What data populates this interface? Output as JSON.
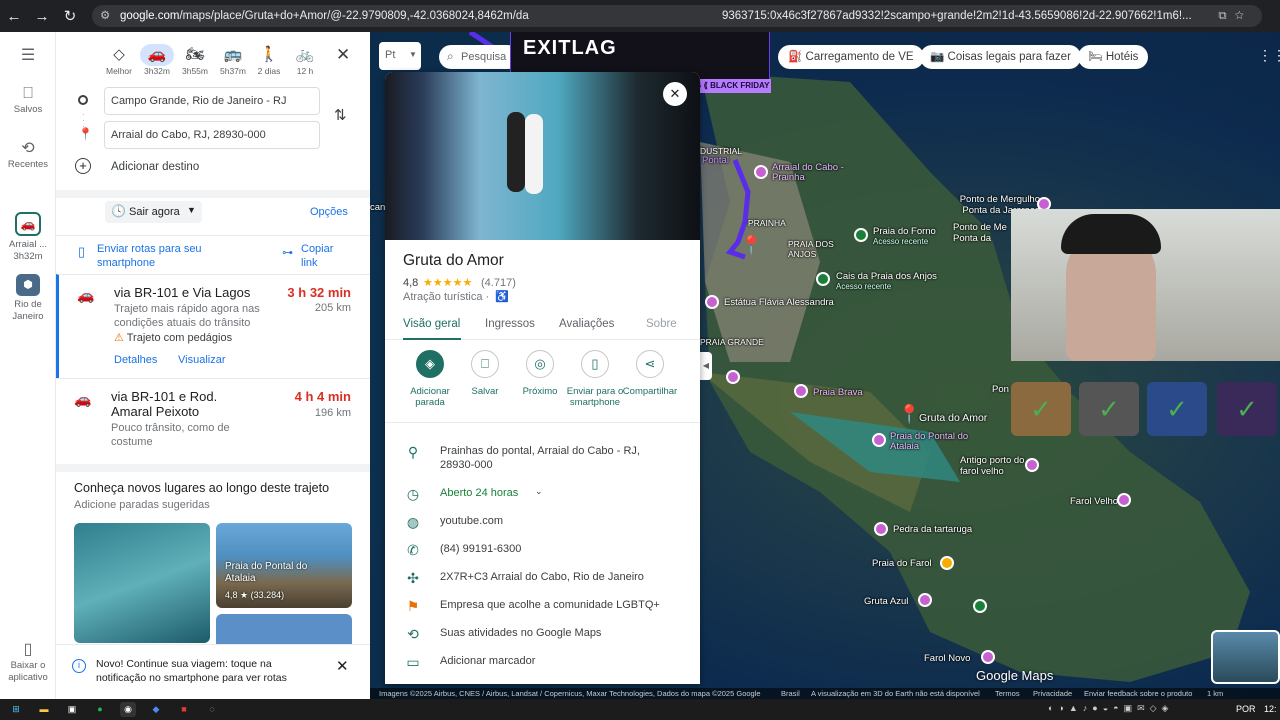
{
  "browser": {
    "url_host": "google.com",
    "url_rest": "/maps/place/Gruta+do+Amor/@-22.9790809,-42.0368024,8462m/da",
    "url_tail": "9363715:0x46c3f27867ad9332!2scampo+grande!2m2!1d-43.5659086!2d-22.907662!1m6!..."
  },
  "rail": {
    "saved": "Salvos",
    "recent": "Recentes",
    "arraial": "Arraial ...",
    "arraial_time": "3h32m",
    "rio": "Rio de Janeiro",
    "download": "Baixar o aplicativo"
  },
  "modes": [
    {
      "icon": "◇",
      "label": "Melhor"
    },
    {
      "icon": "🚗",
      "label": "3h32m"
    },
    {
      "icon": "🏍",
      "label": "3h55m"
    },
    {
      "icon": "🚌",
      "label": "5h37m"
    },
    {
      "icon": "🚶",
      "label": "2 dias"
    },
    {
      "icon": "🚲",
      "label": "12 h"
    }
  ],
  "origin": "Campo Grande, Rio de Janeiro - RJ",
  "destination": "Arraial do Cabo, RJ, 28930-000",
  "add_destination": "Adicionar destino",
  "leave_now": "Sair agora",
  "options": "Opções",
  "send_routes": "Enviar rotas para seu smartphone",
  "copy_link": "Copiar link",
  "routes": [
    {
      "title": "via BR-101 e Via Lagos",
      "time": "3 h 32 min",
      "dist": "205 km",
      "desc": "Trajeto mais rápido agora nas condições atuais do trânsito",
      "warn": "Trajeto com pedágios",
      "details": "Detalhes",
      "view": "Visualizar"
    },
    {
      "title": "via BR-101 e Rod. Amaral Peixoto",
      "time": "4 h 4 min",
      "dist": "196 km",
      "desc": "Pouco trânsito, como de costume"
    }
  ],
  "discover": {
    "title": "Conheça novos lugares ao longo deste trajeto",
    "subtitle": "Adicione paradas sugeridas",
    "card_name": "Praia do Pontal do Atalaia",
    "card_rating": "4,8 ★ (33.284)"
  },
  "toast": "Novo! Continue sua viagem: toque na notificação no smartphone para ver rotas",
  "place": {
    "name": "Gruta do Amor",
    "rating": "4,8",
    "stars": "★★★★★",
    "reviews": "(4.717)",
    "category": "Atração turística ·",
    "tabs": [
      "Visão geral",
      "Ingressos",
      "Avaliações",
      "Sobre"
    ],
    "actions": [
      "Adicionar parada",
      "Salvar",
      "Próximo",
      "Enviar para o smartphone",
      "Compartilhar"
    ],
    "address": "Prainhas do pontal, Arraial do Cabo - RJ, 28930-000",
    "hours": "Aberto 24 horas",
    "website": "youtube.com",
    "phone": "(84) 99191-6300",
    "plus_code": "2X7R+C3 Arraial do Cabo, Rio de Janeiro",
    "lgbtq": "Empresa que acolhe a comunidade LGBTQ+",
    "activity": "Suas atividades no Google Maps",
    "label": "Adicionar marcador"
  },
  "map": {
    "search_placeholder": "Pesquisa",
    "lang": "Pt",
    "chips": [
      "Carregamento de VE",
      "Coisas legais para fazer",
      "Hotéis"
    ],
    "ad_text": "EXITLAG",
    "ad_banner": "ACK FRIDAY EXITLAG ⟪ BLACK FRIDAY EXITLAG ⟪ BLACK FRIDAY EXITLAG",
    "labels": {
      "arraial": "Arraial do Cabo - Prainha",
      "pontal": "Pontal",
      "dustrial": "DUSTRIAL",
      "prainha": "PRAINHA",
      "praia_anjos": "PRAIA DOS ANJOS",
      "forno": "Praia do Forno",
      "forno_sub": "Acesso recente",
      "cais": "Cais da Praia dos Anjos",
      "cais_sub": "Acesso recente",
      "estatua": "Estátua Flávia Alessandra",
      "praia_grande": "PRAIA GRANDE",
      "praia_brava": "Praia Brava",
      "gruta": "Gruta do Amor",
      "pontal_atalaia": "Praia do Pontal do Atalaia",
      "antigo_porto": "Antigo porto do farol velho",
      "farol_velho": "Farol Velho",
      "tartaruga": "Pedra da tartaruga",
      "praia_farol": "Praia do Farol",
      "gruta_azul": "Gruta Azul",
      "farol_novo": "Farol Novo",
      "mergulho": "Ponto de Mergulho Ponta da Jararaca",
      "ponto_me": "Ponto de Me",
      "ponta": "Ponta da",
      "pon": "Pon",
      "cano": "cano"
    },
    "logo": "Google Maps",
    "attribution": "Imagens ©2025 Airbus, CNES / Airbus, Landsat / Copernicus, Maxar Technologies, Dados do mapa ©2025 Google",
    "brasil": "Brasil",
    "earth_note": "A visualização em 3D do Earth não está disponível",
    "terms": "Termos",
    "privacy": "Privacidade",
    "feedback": "Enviar feedback sobre o produto",
    "scale": "1 km"
  },
  "taskbar": {
    "lang": "POR",
    "time": "12:"
  }
}
